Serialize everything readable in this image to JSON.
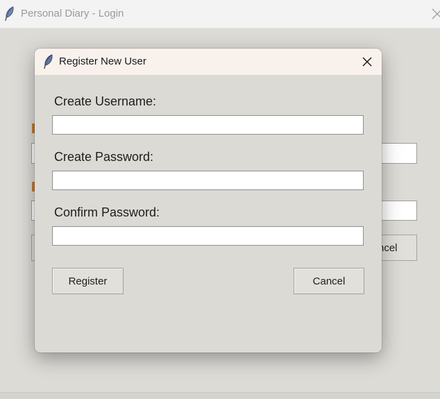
{
  "main_window": {
    "title": "Personal Diary - Login",
    "icon": "feather-icon",
    "close_icon": "close-icon",
    "cancel_partial_label": "ncel"
  },
  "dialog": {
    "title": "Register New User",
    "icon": "feather-icon",
    "close_icon": "close-icon",
    "fields": [
      {
        "label": "Create Username:",
        "value": ""
      },
      {
        "label": "Create Password:",
        "value": ""
      },
      {
        "label": "Confirm Password:",
        "value": ""
      }
    ],
    "buttons": {
      "register": "Register",
      "cancel": "Cancel"
    }
  },
  "colors": {
    "dialog_titlebar": "#f9f1ec",
    "window_bg": "#dcdad5",
    "label_accent": "#c87a2a"
  }
}
